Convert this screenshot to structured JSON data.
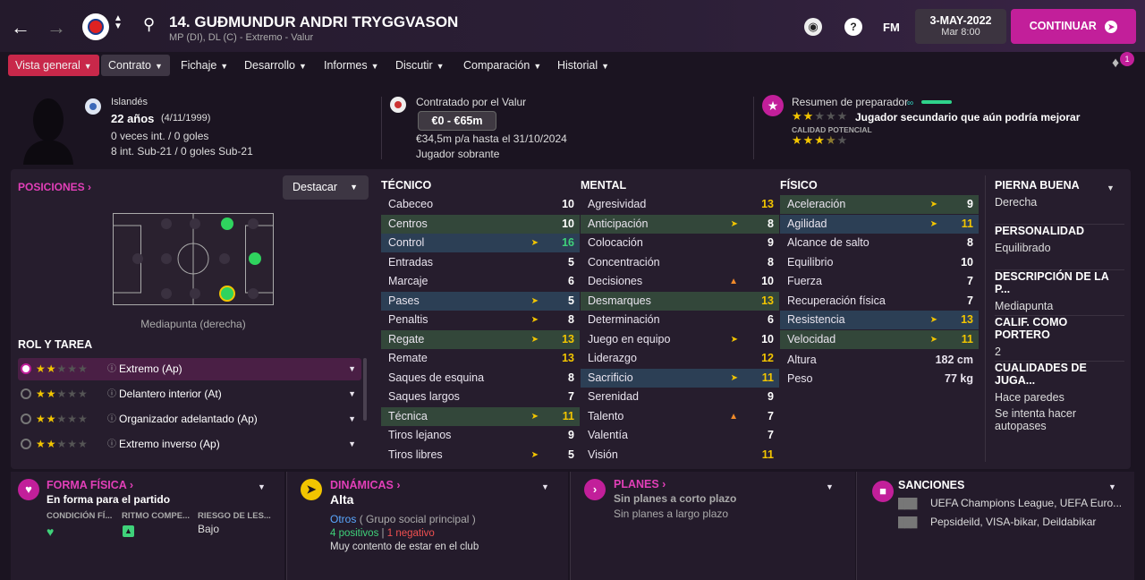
{
  "header": {
    "title": "14. GUÐMUNDUR ANDRI TRYGGVASON",
    "subtitle": "MP (DI), DL (C) - Extremo - Valur",
    "date": "3-MAY-2022",
    "time": "Mar 8:00",
    "fm": "FM",
    "continue": "CONTINUAR"
  },
  "tabs": [
    "Vista general",
    "Contrato",
    "Fichaje",
    "Desarrollo",
    "Informes",
    "Discutir",
    "Comparación",
    "Historial"
  ],
  "notif_count": "1",
  "profile": {
    "nationality": "Islandés",
    "age": "22 años",
    "dob": "(4/11/1999)",
    "caps": "0 veces int. / 0 goles",
    "u21": "8 int. Sub-21 / 0 goles Sub-21"
  },
  "contract": {
    "title": "Contratado por el Valur",
    "value": "€0 - €65m",
    "wage": "€34,5m p/a hasta el 31/10/2024",
    "status": "Jugador sobrante"
  },
  "coach": {
    "title": "Resumen de preparador",
    "verdict": "Jugador secundario que aún podría mejorar",
    "potential_label": "CALIDAD POTENCIAL",
    "current_stars": 2,
    "potential_stars": 3.5
  },
  "positions": {
    "title": "POSICIONES",
    "highlight": "Destacar",
    "caption": "Mediapunta (derecha)"
  },
  "roles": {
    "title": "ROL Y TAREA",
    "items": [
      {
        "name": "Extremo (Ap)",
        "stars": 2
      },
      {
        "name": "Delantero interior (At)",
        "stars": 2
      },
      {
        "name": "Organizador adelantado (Ap)",
        "stars": 2
      },
      {
        "name": "Extremo inverso (Ap)",
        "stars": 2
      }
    ]
  },
  "technical": {
    "title": "TÉCNICO",
    "items": [
      {
        "n": "Cabeceo",
        "v": "10"
      },
      {
        "n": "Centros",
        "v": "10"
      },
      {
        "n": "Control",
        "v": "16"
      },
      {
        "n": "Entradas",
        "v": "5"
      },
      {
        "n": "Marcaje",
        "v": "6"
      },
      {
        "n": "Pases",
        "v": "5"
      },
      {
        "n": "Penaltis",
        "v": "8"
      },
      {
        "n": "Regate",
        "v": "13"
      },
      {
        "n": "Remate",
        "v": "13"
      },
      {
        "n": "Saques de esquina",
        "v": "8"
      },
      {
        "n": "Saques largos",
        "v": "7"
      },
      {
        "n": "Técnica",
        "v": "11"
      },
      {
        "n": "Tiros lejanos",
        "v": "9"
      },
      {
        "n": "Tiros libres",
        "v": "5"
      }
    ]
  },
  "mental": {
    "title": "MENTAL",
    "items": [
      {
        "n": "Agresividad",
        "v": "13"
      },
      {
        "n": "Anticipación",
        "v": "8"
      },
      {
        "n": "Colocación",
        "v": "9"
      },
      {
        "n": "Concentración",
        "v": "8"
      },
      {
        "n": "Decisiones",
        "v": "10"
      },
      {
        "n": "Desmarques",
        "v": "13"
      },
      {
        "n": "Determinación",
        "v": "6"
      },
      {
        "n": "Juego en equipo",
        "v": "10"
      },
      {
        "n": "Liderazgo",
        "v": "12"
      },
      {
        "n": "Sacrificio",
        "v": "11"
      },
      {
        "n": "Serenidad",
        "v": "9"
      },
      {
        "n": "Talento",
        "v": "7"
      },
      {
        "n": "Valentía",
        "v": "7"
      },
      {
        "n": "Visión",
        "v": "11"
      }
    ]
  },
  "physical": {
    "title": "FÍSICO",
    "items": [
      {
        "n": "Aceleración",
        "v": "9"
      },
      {
        "n": "Agilidad",
        "v": "11"
      },
      {
        "n": "Alcance de salto",
        "v": "8"
      },
      {
        "n": "Equilibrio",
        "v": "10"
      },
      {
        "n": "Fuerza",
        "v": "7"
      },
      {
        "n": "Recuperación física",
        "v": "7"
      },
      {
        "n": "Resistencia",
        "v": "13"
      },
      {
        "n": "Velocidad",
        "v": "11"
      }
    ],
    "height_label": "Altura",
    "height": "182 cm",
    "weight_label": "Peso",
    "weight": "77 kg"
  },
  "right_panel": [
    {
      "h": "PIERNA BUENA",
      "v": "Derecha"
    },
    {
      "h": "PERSONALIDAD",
      "v": "Equilibrado"
    },
    {
      "h": "DESCRIPCIÓN DE LA P...",
      "v": "Mediapunta"
    },
    {
      "h": "CALIF. COMO PORTERO",
      "v": "2"
    },
    {
      "h": "CUALIDADES DE JUGA...",
      "v": "Hace paredes",
      "v2": "Se intenta hacer autopases"
    }
  ],
  "bottom": {
    "fitness": {
      "title": "FORMA FÍSICA",
      "status": "En forma para el partido",
      "cols": [
        "CONDICIÓN FÍ...",
        "RITMO COMPE...",
        "RIESGO DE LES..."
      ],
      "risk": "Bajo"
    },
    "dynamics": {
      "title": "DINÁMICAS",
      "value": "Alta",
      "group": "Otros",
      "group_desc": "( Grupo social principal )",
      "pos": "4 positivos",
      "neg": "1 negativo",
      "happy": "Muy contento de estar en el club"
    },
    "plans": {
      "title": "PLANES",
      "short": "Sin planes a corto plazo",
      "long": "Sin planes a largo plazo"
    },
    "sanctions": {
      "title": "SANCIONES",
      "l1": "UEFA Champions League, UEFA Euro...",
      "l2": "Pepsideild, VISA-bikar, Deildabikar"
    }
  },
  "colors": {
    "accent": "#c21f9a",
    "tab_active": "#c8284a",
    "green": "#3fd27a",
    "yellow": "#f2c500",
    "blue": "#5aa8ff"
  }
}
